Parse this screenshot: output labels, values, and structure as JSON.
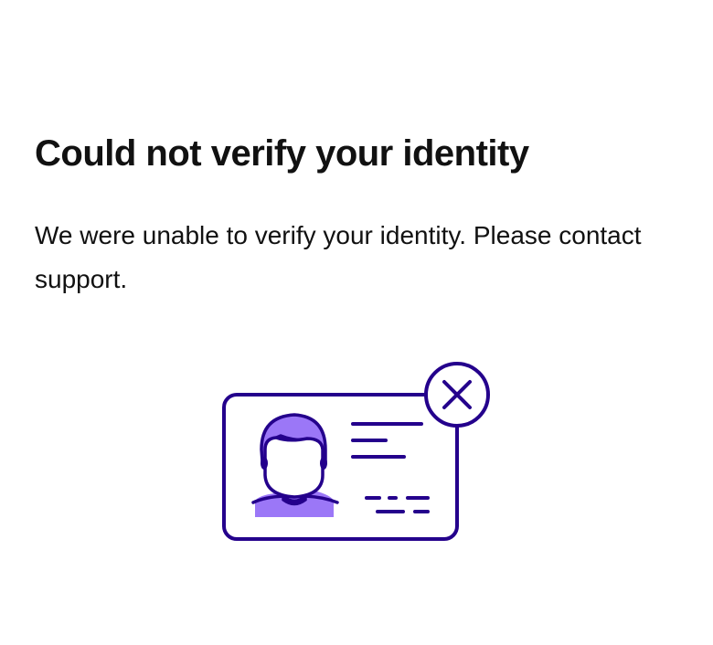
{
  "page": {
    "title": "Could not verify your identity",
    "message": "We were unable to verify your identity. Please contact support."
  },
  "illustration": {
    "icon": "id-card-failed-icon",
    "status_icon": "close-icon",
    "colors": {
      "outline": "#24008C",
      "accent": "#9B77F7",
      "background": "#FFFFFF"
    }
  }
}
